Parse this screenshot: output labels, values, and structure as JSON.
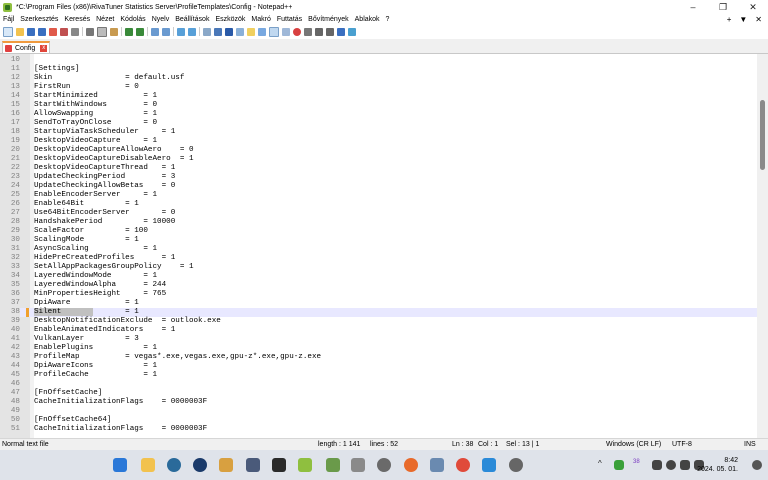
{
  "window": {
    "title": "*C:\\Program Files (x86)\\RivaTuner Statistics Server\\ProfileTemplates\\Config - Notepad++",
    "minimize": "–",
    "maximize": "❐",
    "close": "✕"
  },
  "menu": {
    "items": [
      "Fájl",
      "Szerkesztés",
      "Keresés",
      "Nézet",
      "Kódolás",
      "Nyelv",
      "Beállítások",
      "Eszközök",
      "Makró",
      "Futtatás",
      "Bővítmények",
      "Ablakok",
      "?"
    ],
    "right_plus": "+",
    "right_down": "▼",
    "right_close": "✕"
  },
  "tab": {
    "label": "Config",
    "close": "x"
  },
  "editor": {
    "current_line": 38,
    "selection": "Silent",
    "lines": [
      {
        "n": "10",
        "t": ""
      },
      {
        "n": "11",
        "t": "[Settings]"
      },
      {
        "n": "12",
        "t": "Skin                = default.usf"
      },
      {
        "n": "13",
        "t": "FirstRun            = 0"
      },
      {
        "n": "14",
        "t": "StartMinimized          = 1"
      },
      {
        "n": "15",
        "t": "StartWithWindows        = 0"
      },
      {
        "n": "16",
        "t": "AllowSwapping           = 1"
      },
      {
        "n": "17",
        "t": "SendToTrayOnClose       = 0"
      },
      {
        "n": "18",
        "t": "StartupViaTaskScheduler     = 1"
      },
      {
        "n": "19",
        "t": "DesktopVideoCapture     = 1"
      },
      {
        "n": "20",
        "t": "DesktopVideoCaptureAllowAero    = 0"
      },
      {
        "n": "21",
        "t": "DesktopVideoCaptureDisableAero  = 1"
      },
      {
        "n": "22",
        "t": "DesktopVideoCaptureThread   = 1"
      },
      {
        "n": "23",
        "t": "UpdateCheckingPeriod        = 3"
      },
      {
        "n": "24",
        "t": "UpdateCheckingAllowBetas    = 0"
      },
      {
        "n": "25",
        "t": "EnableEncoderServer     = 1"
      },
      {
        "n": "26",
        "t": "Enable64Bit         = 1"
      },
      {
        "n": "27",
        "t": "Use64BitEncoderServer       = 0"
      },
      {
        "n": "28",
        "t": "HandshakePeriod         = 10000"
      },
      {
        "n": "29",
        "t": "ScaleFactor         = 100"
      },
      {
        "n": "30",
        "t": "ScalingMode         = 1"
      },
      {
        "n": "31",
        "t": "AsyncScaling            = 1"
      },
      {
        "n": "32",
        "t": "HidePreCreatedProfiles      = 1"
      },
      {
        "n": "33",
        "t": "SetAllAppPackagesGroupPolicy    = 1"
      },
      {
        "n": "34",
        "t": "LayeredWindowMode       = 1"
      },
      {
        "n": "35",
        "t": "LayeredWindowAlpha      = 244"
      },
      {
        "n": "36",
        "t": "MinPropertiesHeight     = 765"
      },
      {
        "n": "37",
        "t": "DpiAware            = 1"
      },
      {
        "n": "38",
        "t": "Silent              = 1"
      },
      {
        "n": "39",
        "t": "DesktopNotificationExclude  = outlook.exe"
      },
      {
        "n": "40",
        "t": "EnableAnimatedIndicators    = 1"
      },
      {
        "n": "41",
        "t": "VulkanLayer         = 3"
      },
      {
        "n": "42",
        "t": "EnablePlugins           = 1"
      },
      {
        "n": "43",
        "t": "ProfileMap          = vegas*.exe,vegas.exe,gpu-z*.exe,gpu-z.exe"
      },
      {
        "n": "44",
        "t": "DpiAwareIcons           = 1"
      },
      {
        "n": "45",
        "t": "ProfileCache            = 1"
      },
      {
        "n": "46",
        "t": ""
      },
      {
        "n": "47",
        "t": "[FnOffsetCache]"
      },
      {
        "n": "48",
        "t": "CacheInitializationFlags    = 0000003F"
      },
      {
        "n": "49",
        "t": ""
      },
      {
        "n": "50",
        "t": "[FnOffsetCache64]"
      },
      {
        "n": "51",
        "t": "CacheInitializationFlags    = 0000003F"
      }
    ]
  },
  "status": {
    "type": "Normal text file",
    "length": "length : 1 141",
    "lines": "lines : 52",
    "position": "Ln : 38",
    "column": "Col : 1",
    "selection": "Sel : 13 | 1",
    "eol": "Windows (CR LF)",
    "encoding": "UTF-8",
    "mode": "INS"
  },
  "taskbar": {
    "time": "8:42",
    "date": "2024. 05. 01.",
    "tray_up": "^",
    "tray_badge": "38"
  }
}
